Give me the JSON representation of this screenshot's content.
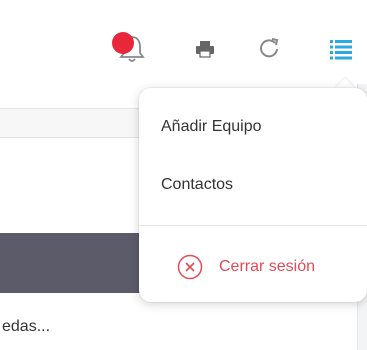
{
  "toolbar": {
    "icons": [
      "bell-icon",
      "print-icon",
      "reload-icon",
      "menu-icon"
    ],
    "notification_color": "#e8283a",
    "menu_icon_color": "#2ca9df"
  },
  "content": {
    "row_text": "edas..."
  },
  "dropdown": {
    "items": [
      {
        "label": "Añadir Equipo"
      },
      {
        "label": "Contactos"
      }
    ],
    "logout_label": "Cerrar sesión",
    "logout_color": "#e24b55"
  }
}
